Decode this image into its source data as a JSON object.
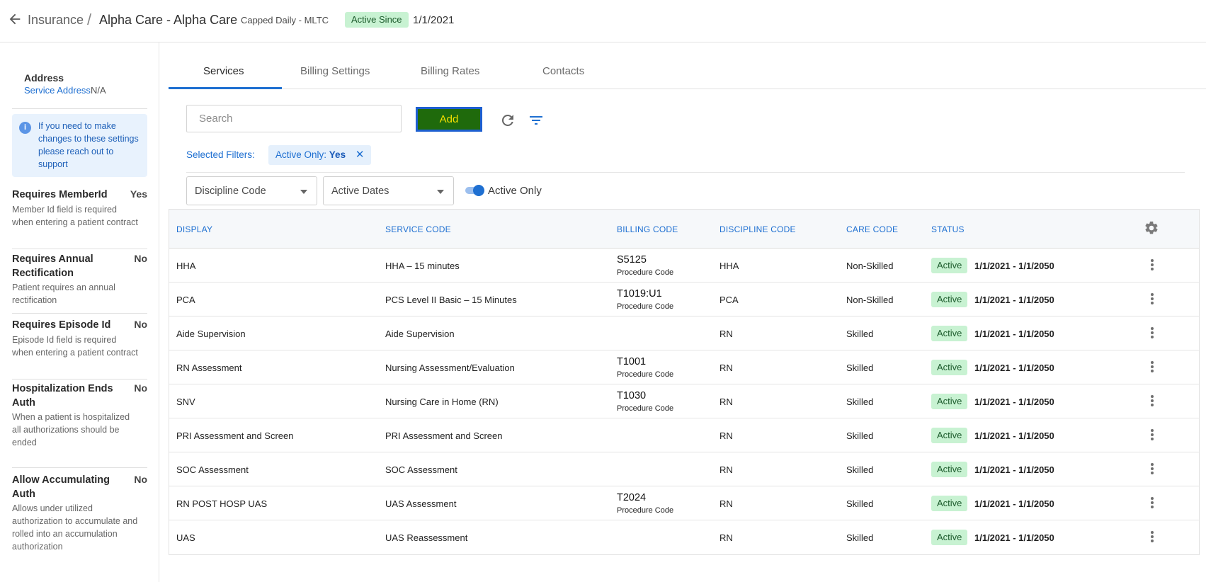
{
  "header": {
    "back_icon": "arrow-left-icon",
    "breadcrumb_root": "Insurance",
    "breadcrumb_sep": "/",
    "breadcrumb_current": "Alpha Care - Alpha Care",
    "plan_type": "Capped Daily - MLTC",
    "active_since_label": "Active Since",
    "active_since_date": "1/1/2021"
  },
  "sidebar": {
    "address_title": "Address",
    "service_address_label": "Service Address",
    "service_address_value": "N/A",
    "info_text": "If you need to make changes to these settings please reach out to support",
    "settings": [
      {
        "title": "Requires MemberId",
        "value": "Yes",
        "desc": "Member Id field is required when entering a patient contract"
      },
      {
        "title": "Requires Annual Rectification",
        "value": "No",
        "desc": "Patient requires an annual rectification"
      },
      {
        "title": "Requires Episode Id",
        "value": "No",
        "desc": "Episode Id field is required when entering a patient contract"
      },
      {
        "title": "Hospitalization Ends Auth",
        "value": "No",
        "desc": "When a patient is hospitalized all authorizations should be ended"
      },
      {
        "title": "Allow Accumulating Auth",
        "value": "No",
        "desc": "Allows under utilized authorization to accumulate and rolled into an accumulation authorization"
      }
    ]
  },
  "tabs": [
    "Services",
    "Billing Settings",
    "Billing Rates",
    "Contacts"
  ],
  "active_tab": "Services",
  "toolbar": {
    "search_placeholder": "Search",
    "add_label": "Add",
    "refresh_icon": "refresh-icon",
    "filter_icon": "filter-icon"
  },
  "filters": {
    "selected_label": "Selected Filters:",
    "chip_key": "Active Only:",
    "chip_value": "Yes",
    "discipline_placeholder": "Discipline Code",
    "dates_placeholder": "Active Dates",
    "active_only_label": "Active Only",
    "active_only_on": true
  },
  "table": {
    "headers": {
      "display": "DISPLAY",
      "service_code": "SERVICE CODE",
      "billing_code": "BILLING CODE",
      "discipline_code": "DISCIPLINE CODE",
      "care_code": "CARE CODE",
      "status": "STATUS"
    },
    "rows": [
      {
        "display": "HHA",
        "service": "HHA – 15 minutes",
        "billing": "S5125",
        "billing_type": "Procedure Code",
        "discipline": "HHA",
        "care": "Non-Skilled",
        "status": "Active",
        "dates": "1/1/2021 - 1/1/2050"
      },
      {
        "display": "PCA",
        "service": "PCS Level II Basic – 15 Minutes",
        "billing": "T1019:U1",
        "billing_type": "Procedure Code",
        "discipline": "PCA",
        "care": "Non-Skilled",
        "status": "Active",
        "dates": "1/1/2021 - 1/1/2050"
      },
      {
        "display": "Aide Supervision",
        "service": "Aide Supervision",
        "billing": "",
        "billing_type": "",
        "discipline": "RN",
        "care": "Skilled",
        "status": "Active",
        "dates": "1/1/2021 - 1/1/2050"
      },
      {
        "display": "RN Assessment",
        "service": "Nursing Assessment/Evaluation",
        "billing": "T1001",
        "billing_type": "Procedure Code",
        "discipline": "RN",
        "care": "Skilled",
        "status": "Active",
        "dates": "1/1/2021 - 1/1/2050"
      },
      {
        "display": "SNV",
        "service": "Nursing Care in Home (RN)",
        "billing": "T1030",
        "billing_type": "Procedure Code",
        "discipline": "RN",
        "care": "Skilled",
        "status": "Active",
        "dates": "1/1/2021 - 1/1/2050"
      },
      {
        "display": "PRI Assessment and Screen",
        "service": "PRI Assessment and Screen",
        "billing": "",
        "billing_type": "",
        "discipline": "RN",
        "care": "Skilled",
        "status": "Active",
        "dates": "1/1/2021 - 1/1/2050"
      },
      {
        "display": "SOC Assessment",
        "service": "SOC Assessment",
        "billing": "",
        "billing_type": "",
        "discipline": "RN",
        "care": "Skilled",
        "status": "Active",
        "dates": "1/1/2021 - 1/1/2050"
      },
      {
        "display": "RN POST HOSP UAS",
        "service": "UAS Assessment",
        "billing": "T2024",
        "billing_type": "Procedure Code",
        "discipline": "RN",
        "care": "Skilled",
        "status": "Active",
        "dates": "1/1/2021 - 1/1/2050"
      },
      {
        "display": "UAS",
        "service": "UAS Reassessment",
        "billing": "",
        "billing_type": "",
        "discipline": "RN",
        "care": "Skilled",
        "status": "Active",
        "dates": "1/1/2021 - 1/1/2050"
      }
    ]
  },
  "colors": {
    "accent": "#1e6fd1",
    "status_bg": "#c8f2d2",
    "add_button_bg": "#1f6a0c",
    "add_button_text": "#f4e000"
  }
}
